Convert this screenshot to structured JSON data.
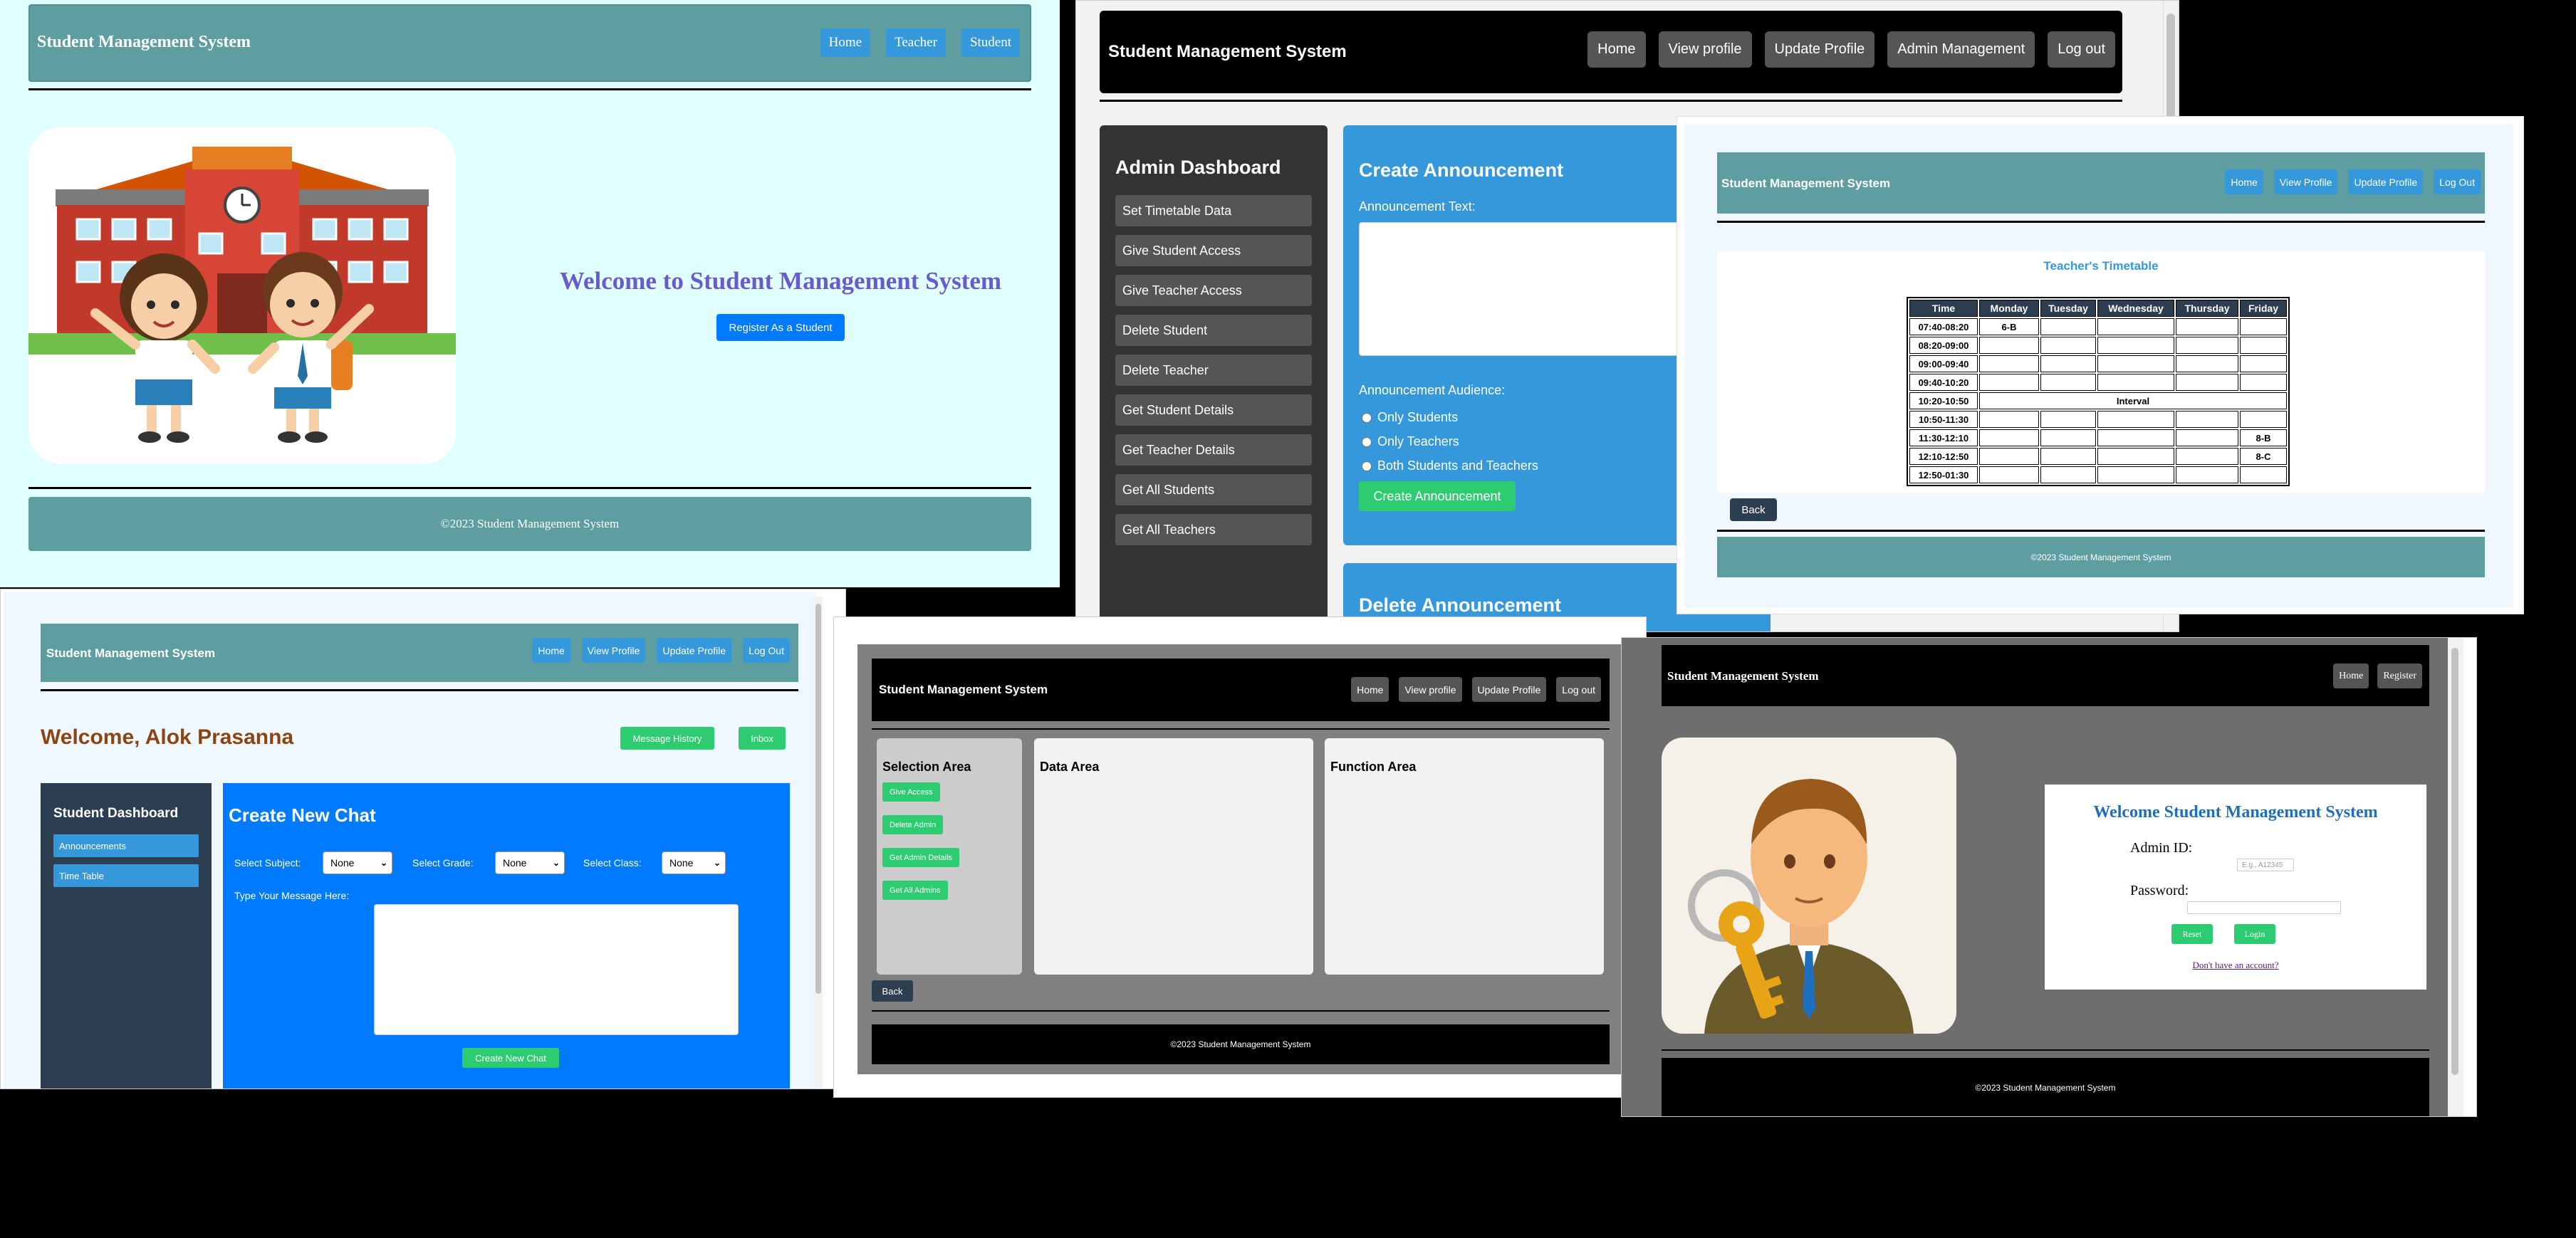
{
  "landing": {
    "title": "Student Management System",
    "nav": [
      "Home",
      "Teacher",
      "Student"
    ],
    "welcome": "Welcome to Student Management System",
    "register": "Register As a Student",
    "footer": "©2023 Student Management System"
  },
  "admin": {
    "title": "Student Management System",
    "nav": [
      "Home",
      "View profile",
      "Update Profile",
      "Admin Management",
      "Log out"
    ],
    "sidebar_title": "Admin Dashboard",
    "sidebar": [
      "Set Timetable Data",
      "Give Student Access",
      "Give Teacher Access",
      "Delete Student",
      "Delete Teacher",
      "Get Student Details",
      "Get Teacher Details",
      "Get All Students",
      "Get All Teachers"
    ],
    "create_title": "Create Announcement",
    "text_label": "Announcement Text:",
    "audience_label": "Announcement Audience:",
    "audience": [
      "Only Students",
      "Only Teachers",
      "Both Students and Teachers"
    ],
    "create_button": "Create Announcement",
    "delete_title": "Delete Announcement"
  },
  "timetable": {
    "title": "Student Management System",
    "nav": [
      "Home",
      "View Profile",
      "Update Profile",
      "Log Out"
    ],
    "heading": "Teacher's Timetable",
    "columns": [
      "Time",
      "Monday",
      "Tuesday",
      "Wednesday",
      "Thursday",
      "Friday"
    ],
    "rows": [
      [
        "07:40-08:20",
        "6-B",
        "",
        "",
        "",
        ""
      ],
      [
        "08:20-09:00",
        "",
        "",
        "",
        "",
        ""
      ],
      [
        "09:00-09:40",
        "",
        "",
        "",
        "",
        ""
      ],
      [
        "09:40-10:20",
        "",
        "",
        "",
        "",
        ""
      ],
      [
        "10:20-10:50",
        "Interval"
      ],
      [
        "10:50-11:30",
        "",
        "",
        "",
        "",
        ""
      ],
      [
        "11:30-12:10",
        "",
        "",
        "",
        "",
        "8-B"
      ],
      [
        "12:10-12:50",
        "",
        "",
        "",
        "",
        "8-C"
      ],
      [
        "12:50-01:30",
        "",
        "",
        "",
        "",
        ""
      ]
    ],
    "back": "Back",
    "footer": "©2023 Student Management System"
  },
  "student": {
    "title": "Student Management System",
    "nav": [
      "Home",
      "View Profile",
      "Update Profile",
      "Log Out"
    ],
    "welcome": "Welcome, Alok Prasanna",
    "message_history": "Message History",
    "inbox": "Inbox",
    "sidebar_title": "Student Dashboard",
    "sidebar": [
      "Announcements",
      "Time Table"
    ],
    "chat_title": "Create New Chat",
    "subject_label": "Select Subject:",
    "grade_label": "Select Grade:",
    "class_label": "Select Class:",
    "subject_value": "None",
    "grade_value": "None",
    "class_value": "None",
    "message_label": "Type Your Message Here:",
    "create_button": "Create New Chat"
  },
  "access": {
    "title": "Student Management System",
    "nav": [
      "Home",
      "View profile",
      "Update Profile",
      "Log out"
    ],
    "selection_title": "Selection Area",
    "selection": [
      "Give Access",
      "Delete Admin",
      "Get Admin Details",
      "Get All Admins"
    ],
    "data_title": "Data Area",
    "function_title": "Function Area",
    "back": "Back",
    "footer": "©2023 Student Management System"
  },
  "login": {
    "title": "Student Management System",
    "nav": [
      "Home",
      "Register"
    ],
    "heading": "Welcome Student Management System",
    "id_label": "Admin ID:",
    "id_placeholder": "E.g., A12345",
    "password_label": "Password:",
    "reset": "Reset",
    "login": "Login",
    "signup_link": "Don't have an account?",
    "footer": "©2023 Student Management System"
  },
  "colors": {
    "teal": "#5f9ea0",
    "blue": "#3498db",
    "green": "#2ecc71",
    "navy": "#2c3e50",
    "violet_heading": "#6a5acd"
  }
}
